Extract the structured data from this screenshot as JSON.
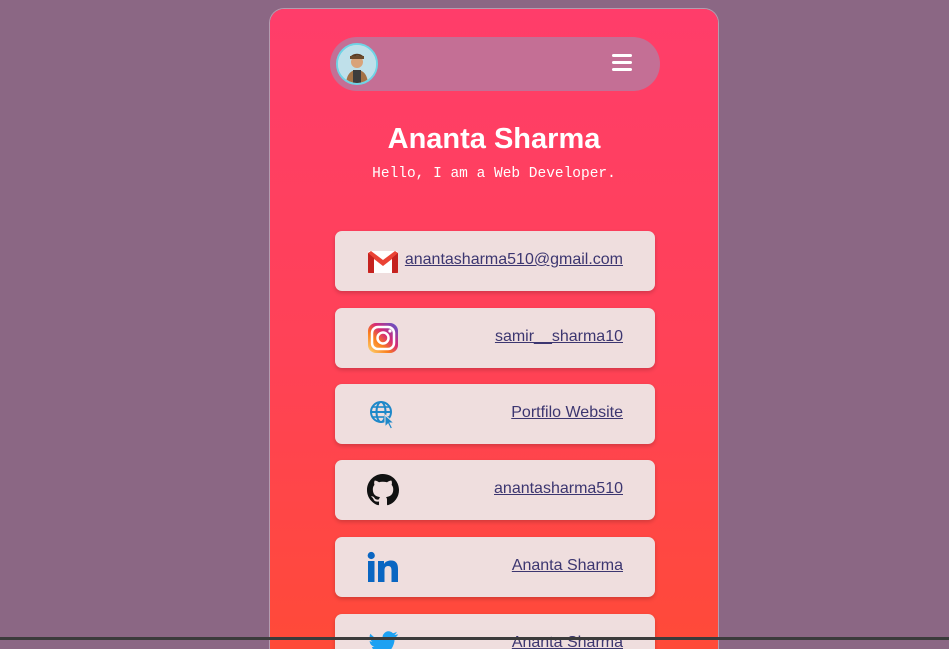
{
  "profile": {
    "name": "Ananta Sharma",
    "tagline": "Hello, I am a Web Developer."
  },
  "nav": {
    "avatar_icon": "profile-photo",
    "menu_icon": "hamburger-menu-icon"
  },
  "links": [
    {
      "icon": "gmail-icon",
      "label": "anantasharma510@gmail.com"
    },
    {
      "icon": "instagram-icon",
      "label": "samir__sharma10"
    },
    {
      "icon": "globe-cursor-icon",
      "label": "Portfilo Website"
    },
    {
      "icon": "github-icon",
      "label": "anantasharma510"
    },
    {
      "icon": "linkedin-icon",
      "label": "Ananta Sharma"
    },
    {
      "icon": "twitter-icon",
      "label": "Ananta Sharma"
    }
  ],
  "colors": {
    "page_background": "#8b6784",
    "card_gradient_top": "#ff3d6a",
    "card_gradient_bottom": "#ff4a38",
    "navbar": "#c46f95",
    "link_card": "#efdede",
    "link_text": "#3c3670"
  }
}
